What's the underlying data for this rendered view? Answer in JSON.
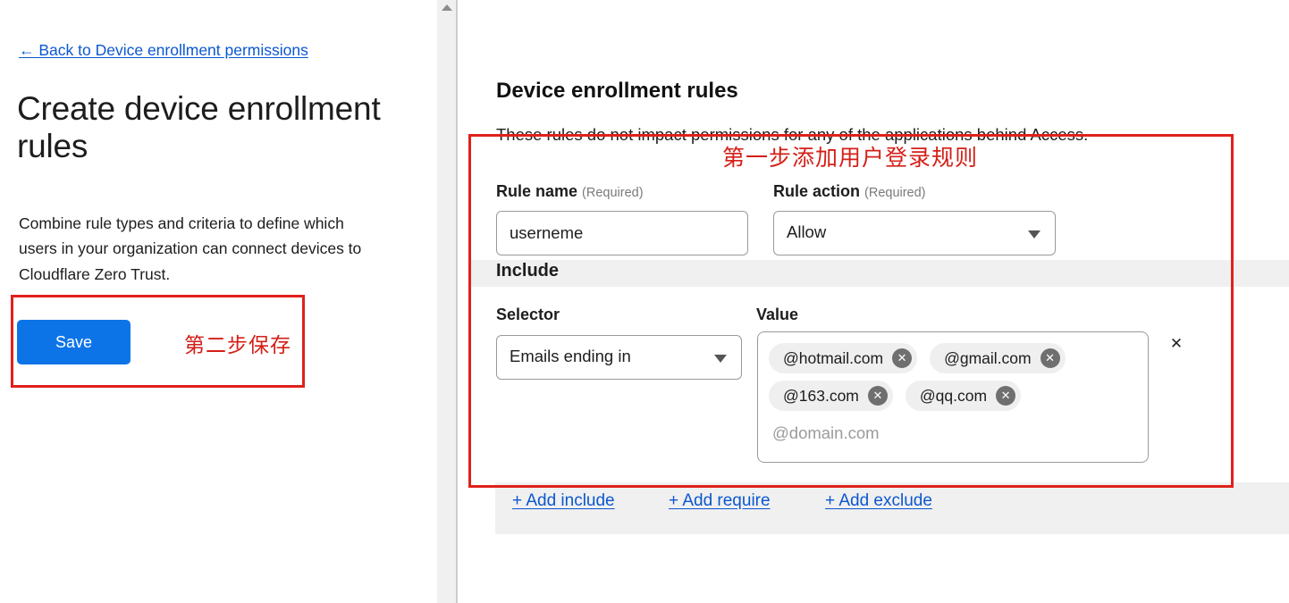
{
  "left_panel": {
    "back_link": "← Back to Device enrollment permissions",
    "title": "Create device enrollment rules",
    "description": "Combine rule types and criteria to define which users in your organization can connect devices to Cloudflare Zero Trust.",
    "save_button": "Save",
    "save_step_note": "第二步保存",
    "annotation_color": "#e0211b",
    "save_button_color": "#0d74e7"
  },
  "scrollbar": {
    "up_arrow_icon": "chevron-up-icon"
  },
  "right_panel": {
    "section_title": "Device enrollment rules",
    "section_subtitle": "These rules do not impact permissions for any of the applications behind Access.",
    "rule_step_note": "第一步添加用户登录规则",
    "required_tag": "(Required)",
    "rule_name": {
      "label": "Rule name",
      "value": "userneme"
    },
    "rule_action": {
      "label": "Rule action",
      "value": "Allow",
      "caret_icon": "chevron-down-icon"
    },
    "include": {
      "heading": "Include",
      "selector_label": "Selector",
      "value_label": "Value",
      "selector_value": "Emails ending in",
      "selector_caret_icon": "chevron-down-icon",
      "value_placeholder": "@domain.com",
      "tags": [
        {
          "label": "@hotmail.com",
          "remove_icon": "close-icon"
        },
        {
          "label": "@gmail.com",
          "remove_icon": "close-icon"
        },
        {
          "label": "@163.com",
          "remove_icon": "close-icon"
        },
        {
          "label": "@qq.com",
          "remove_icon": "close-icon"
        }
      ],
      "remove_condition_icon": "✕"
    },
    "add_links": {
      "include": "+ Add include",
      "require": "+ Add require",
      "exclude": "+ Add exclude"
    }
  }
}
